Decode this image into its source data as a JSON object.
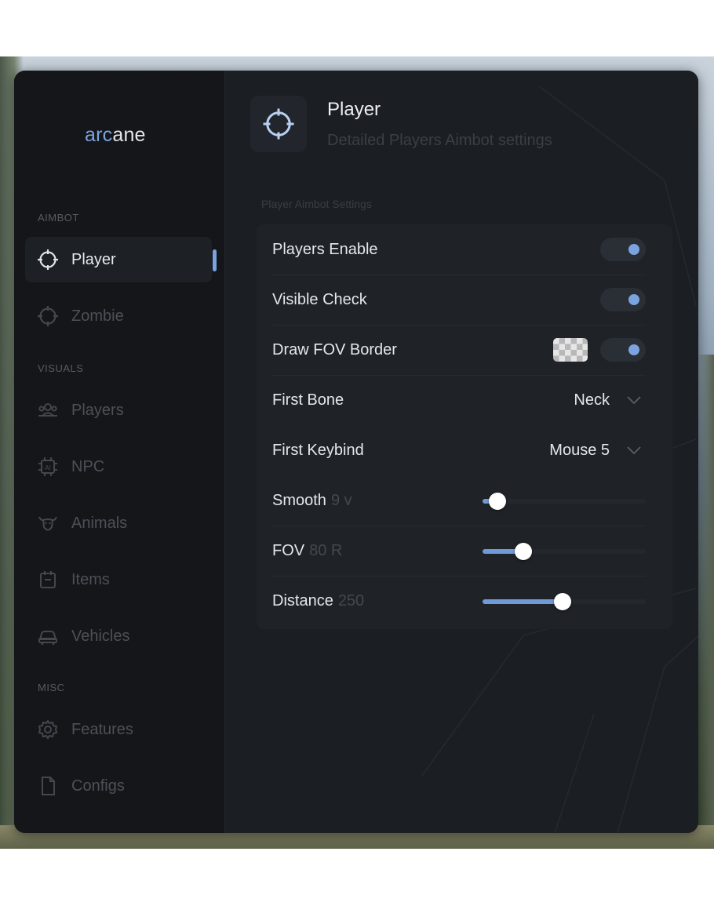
{
  "app": {
    "logo_accent": "arc",
    "logo_rest": "ane"
  },
  "sidebar": {
    "sections": [
      {
        "label": "AIMBOT"
      },
      {
        "label": "VISUALS"
      },
      {
        "label": "MISC"
      }
    ],
    "items": [
      {
        "label": "Player",
        "icon": "crosshair-icon",
        "active": true
      },
      {
        "label": "Zombie",
        "icon": "zombie-crosshair-icon",
        "active": false
      },
      {
        "label": "Players",
        "icon": "people-icon",
        "active": false
      },
      {
        "label": "NPC",
        "icon": "ai-chip-icon",
        "active": false
      },
      {
        "label": "Animals",
        "icon": "bull-head-icon",
        "active": false
      },
      {
        "label": "Items",
        "icon": "calendar-box-icon",
        "active": false
      },
      {
        "label": "Vehicles",
        "icon": "car-icon",
        "active": false
      },
      {
        "label": "Features",
        "icon": "gear-icon",
        "active": false
      },
      {
        "label": "Configs",
        "icon": "file-icon",
        "active": false
      }
    ]
  },
  "header": {
    "title": "Player",
    "subtitle": "Detailed Players Aimbot settings",
    "icon": "crosshair-icon"
  },
  "settings": {
    "group_label": "Player Aimbot Settings",
    "players_enable": {
      "label": "Players Enable",
      "on": true
    },
    "visible_check": {
      "label": "Visible Check",
      "on": true
    },
    "draw_fov_border": {
      "label": "Draw FOV Border",
      "on": true
    },
    "first_bone": {
      "label": "First Bone",
      "value": "Neck"
    },
    "first_keybind": {
      "label": "First Keybind",
      "value": "Mouse 5"
    },
    "smooth": {
      "label": "Smooth",
      "value": "9 v",
      "fraction": 0.09
    },
    "fov": {
      "label": "FOV",
      "value": "80 R",
      "fraction": 0.25
    },
    "distance": {
      "label": "Distance",
      "value": "250",
      "fraction": 0.49
    }
  },
  "colors": {
    "accent": "#7aa3e0",
    "window_bg": "#17191d",
    "sidebar_bg": "#141619",
    "panel_bg": "#1f2227"
  }
}
